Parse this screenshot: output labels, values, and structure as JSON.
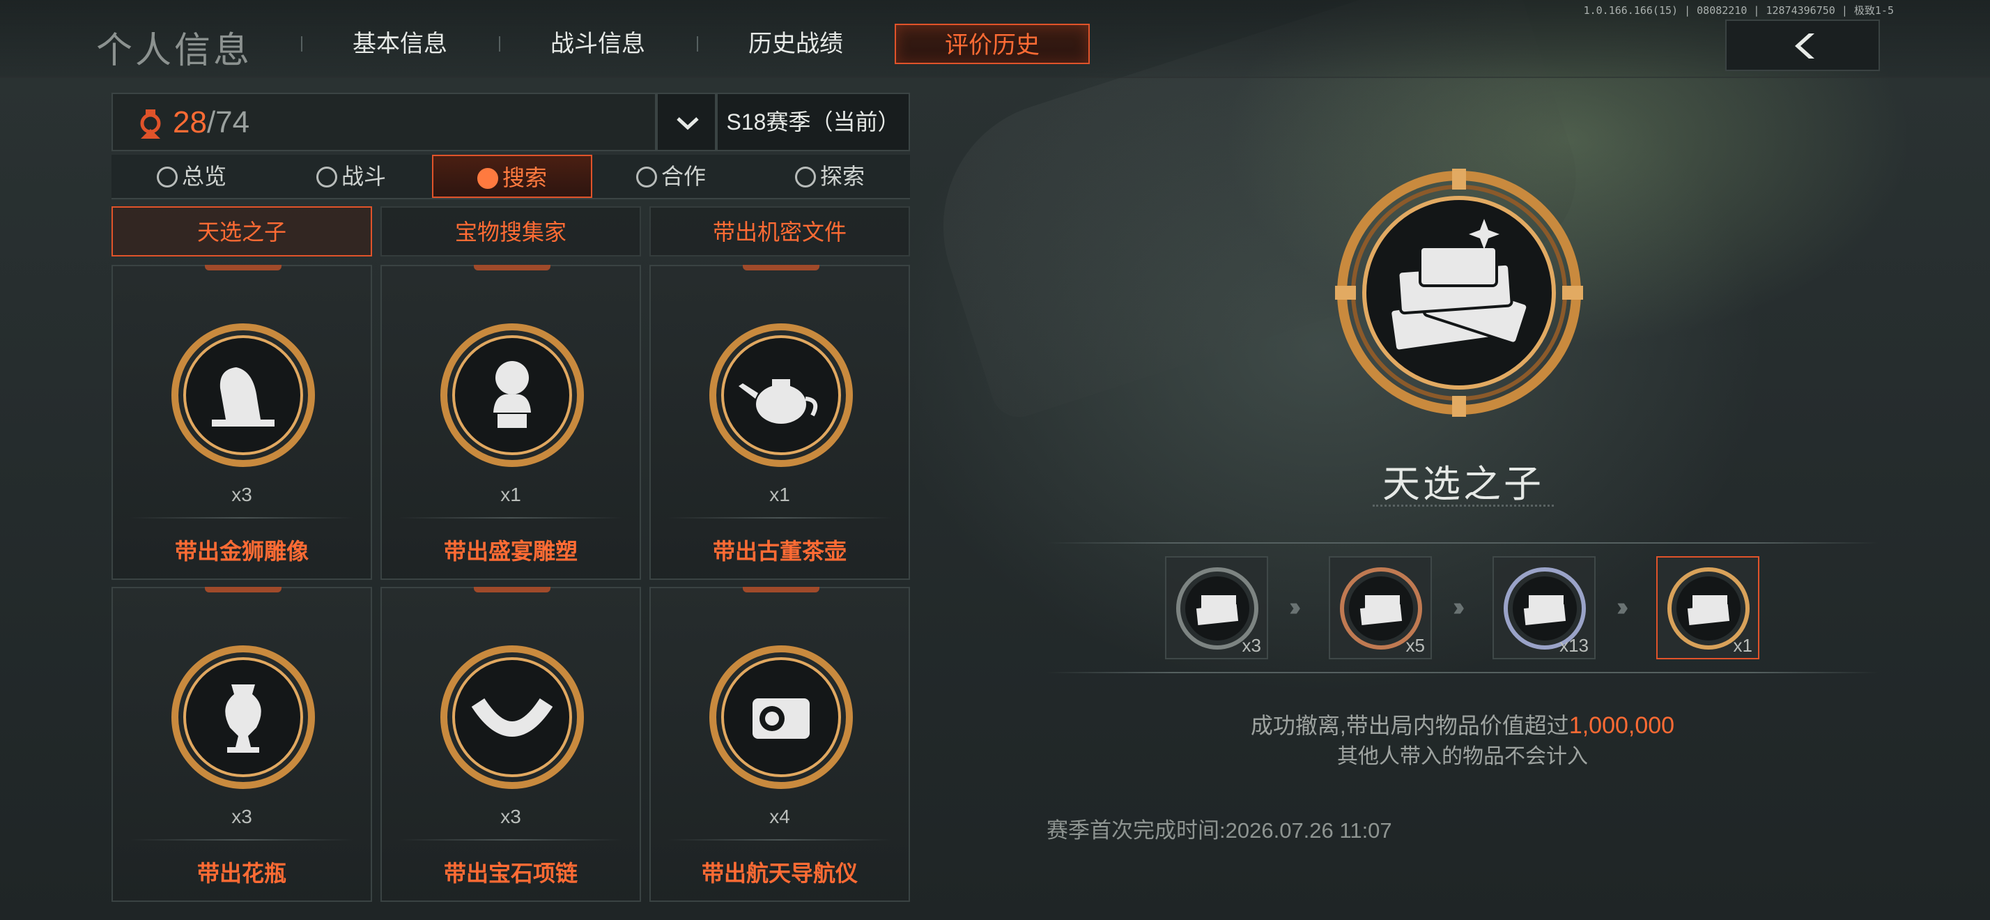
{
  "header": {
    "title": "个人信息",
    "tabs": [
      "基本信息",
      "战斗信息",
      "历史战绩",
      "评价历史"
    ],
    "active_tab": "评价历史",
    "build_info": "1.0.166.166(15) | 08082210 | 12874396750 | 极致1-5"
  },
  "progress": {
    "current": "28",
    "total": "/74"
  },
  "season": {
    "selected": "S18赛季（当前）"
  },
  "subtabs": [
    {
      "label": "总览",
      "icon": "star-icon"
    },
    {
      "label": "战斗",
      "icon": "crosshair-icon"
    },
    {
      "label": "搜索",
      "icon": "search-globe-icon"
    },
    {
      "label": "合作",
      "icon": "handshake-icon"
    },
    {
      "label": "探索",
      "icon": "compass-icon"
    }
  ],
  "active_subtab": "搜索",
  "categories": [
    "天选之子",
    "宝物搜集家",
    "带出机密文件"
  ],
  "active_category": "天选之子",
  "cards": [
    {
      "label": "带出金狮雕像",
      "count": "x3",
      "icon": "lion-statue-icon"
    },
    {
      "label": "带出盛宴雕塑",
      "count": "x1",
      "icon": "bust-statue-icon"
    },
    {
      "label": "带出古董茶壶",
      "count": "x1",
      "icon": "teapot-icon"
    },
    {
      "label": "带出花瓶",
      "count": "x3",
      "icon": "vase-icon"
    },
    {
      "label": "带出宝石项链",
      "count": "x3",
      "icon": "necklace-icon"
    },
    {
      "label": "带出航天导航仪",
      "count": "x4",
      "icon": "navigator-icon"
    }
  ],
  "detail": {
    "title": "天选之子",
    "icon": "money-stack-icon",
    "tiers": [
      {
        "count": "x3",
        "tier": "iron"
      },
      {
        "count": "x5",
        "tier": "bronze"
      },
      {
        "count": "x13",
        "tier": "silver"
      },
      {
        "count": "x1",
        "tier": "gold"
      }
    ],
    "desc_prefix": "成功撤离,带出局内物品价值超过",
    "desc_value": "1,000,000",
    "desc_line2": "其他人带入的物品不会计入",
    "first_time_label": "赛季首次完成时间:",
    "first_time_value": "2026.07.26 11:07"
  },
  "colors": {
    "accent": "#ff6b34",
    "gold": "#d9a25a",
    "bronze": "#c07a52",
    "silver": "#9aa3c8",
    "iron": "#7d8482"
  }
}
